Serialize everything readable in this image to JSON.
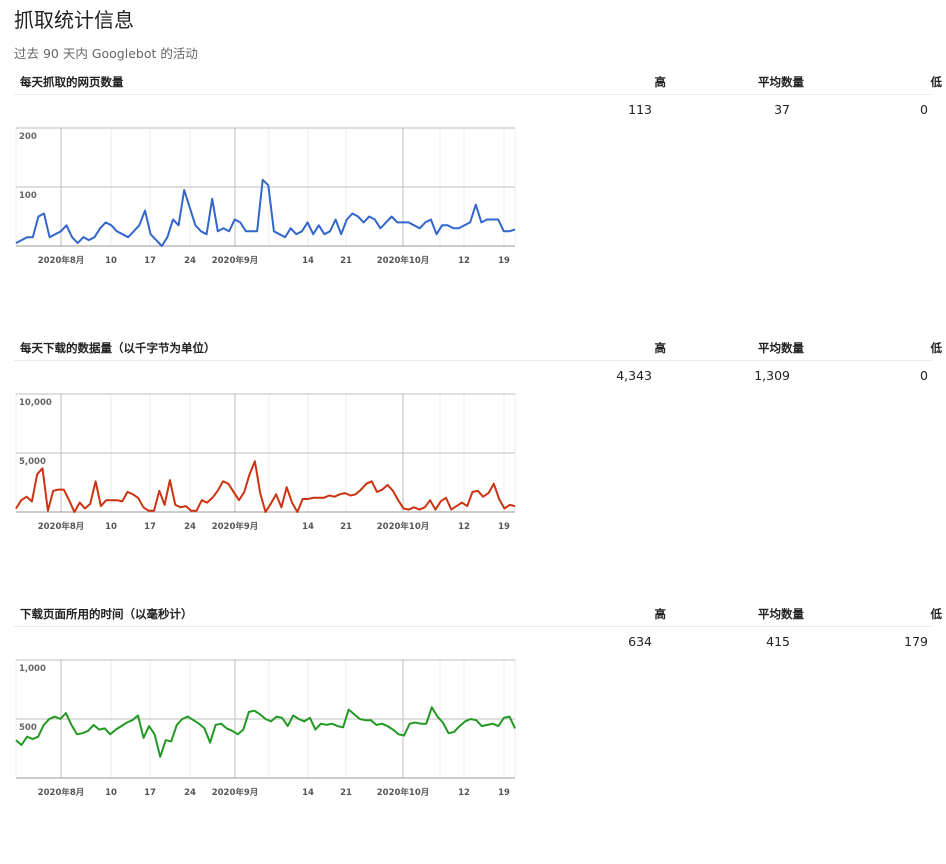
{
  "page": {
    "title": "抓取统计信息",
    "subtitle": "过去 90 天内 Googlebot 的活动"
  },
  "columns": {
    "high": "高",
    "avg": "平均数量",
    "low": "低"
  },
  "chart_data": [
    {
      "type": "line",
      "title": "每天抓取的网页数量",
      "stats": {
        "high": "113",
        "avg": "37",
        "low": "0"
      },
      "color": "#3366cc",
      "ylim": [
        0,
        200
      ],
      "y_ticks": [
        {
          "v": 200,
          "label": "200"
        },
        {
          "v": 100,
          "label": "100"
        }
      ],
      "x_labels": [
        "2020年8月",
        "10",
        "17",
        "24",
        "2020年9月",
        "14",
        "21",
        "2020年10月",
        "12",
        "19"
      ],
      "grid": true,
      "values": [
        5,
        10,
        15,
        15,
        50,
        55,
        15,
        20,
        25,
        35,
        15,
        5,
        15,
        10,
        15,
        30,
        40,
        35,
        25,
        20,
        15,
        25,
        35,
        60,
        20,
        10,
        0,
        15,
        45,
        35,
        95,
        65,
        35,
        25,
        20,
        80,
        25,
        30,
        25,
        45,
        40,
        25,
        25,
        25,
        112,
        103,
        25,
        20,
        15,
        30,
        20,
        25,
        40,
        20,
        35,
        20,
        25,
        45,
        20,
        45,
        55,
        50,
        40,
        50,
        45,
        30,
        40,
        50,
        40,
        40,
        40,
        35,
        30,
        40,
        45,
        20,
        35,
        35,
        30,
        30,
        35,
        40,
        70,
        40,
        45,
        45,
        45,
        25,
        25,
        28
      ]
    },
    {
      "type": "line",
      "title": "每天下载的数据量（以千字节为单位）",
      "stats": {
        "high": "4,343",
        "avg": "1,309",
        "low": "0"
      },
      "color": "#cc3311",
      "ylim": [
        0,
        10000
      ],
      "y_ticks": [
        {
          "v": 10000,
          "label": "10,000"
        },
        {
          "v": 5000,
          "label": "5,000"
        }
      ],
      "x_labels": [
        "2020年8月",
        "10",
        "17",
        "24",
        "2020年9月",
        "14",
        "21",
        "2020年10月",
        "12",
        "19"
      ],
      "grid": true,
      "values": [
        300,
        1000,
        1300,
        900,
        3200,
        3700,
        100,
        1800,
        1900,
        1900,
        1000,
        0,
        800,
        300,
        700,
        2600,
        500,
        1000,
        1000,
        1000,
        900,
        1700,
        1500,
        1200,
        400,
        100,
        100,
        1800,
        600,
        2700,
        600,
        400,
        500,
        100,
        100,
        1000,
        800,
        1200,
        1800,
        2600,
        2400,
        1700,
        1000,
        1700,
        3200,
        4300,
        1600,
        0,
        700,
        1500,
        400,
        2100,
        800,
        0,
        1100,
        1100,
        1200,
        1200,
        1200,
        1400,
        1300,
        1500,
        1600,
        1400,
        1500,
        1900,
        2400,
        2600,
        1700,
        1900,
        2300,
        1800,
        1000,
        300,
        200,
        400,
        200,
        400,
        1000,
        200,
        900,
        1200,
        200,
        500,
        800,
        500,
        1700,
        1800,
        1300,
        1600,
        2400,
        1100,
        300,
        600,
        500
      ]
    },
    {
      "type": "line",
      "title": "下载页面所用的时间（以毫秒计）",
      "stats": {
        "high": "634",
        "avg": "415",
        "low": "179"
      },
      "color": "#229922",
      "ylim": [
        0,
        1000
      ],
      "y_ticks": [
        {
          "v": 1000,
          "label": "1,000"
        },
        {
          "v": 500,
          "label": "500"
        }
      ],
      "x_labels": [
        "2020年8月",
        "10",
        "17",
        "24",
        "2020年9月",
        "14",
        "21",
        "2020年10月",
        "12",
        "19"
      ],
      "grid": true,
      "values": [
        320,
        280,
        350,
        330,
        350,
        450,
        500,
        520,
        500,
        550,
        450,
        370,
        380,
        400,
        450,
        410,
        420,
        370,
        410,
        440,
        470,
        490,
        530,
        340,
        440,
        370,
        180,
        320,
        310,
        450,
        500,
        520,
        490,
        460,
        420,
        300,
        450,
        460,
        420,
        400,
        370,
        410,
        560,
        570,
        540,
        500,
        480,
        520,
        510,
        440,
        530,
        500,
        480,
        510,
        410,
        460,
        450,
        460,
        440,
        430,
        580,
        540,
        500,
        490,
        490,
        450,
        460,
        440,
        410,
        370,
        360,
        460,
        470,
        460,
        460,
        600,
        520,
        470,
        380,
        390,
        440,
        480,
        500,
        490,
        440,
        450,
        460,
        440,
        510,
        520,
        420
      ]
    }
  ]
}
